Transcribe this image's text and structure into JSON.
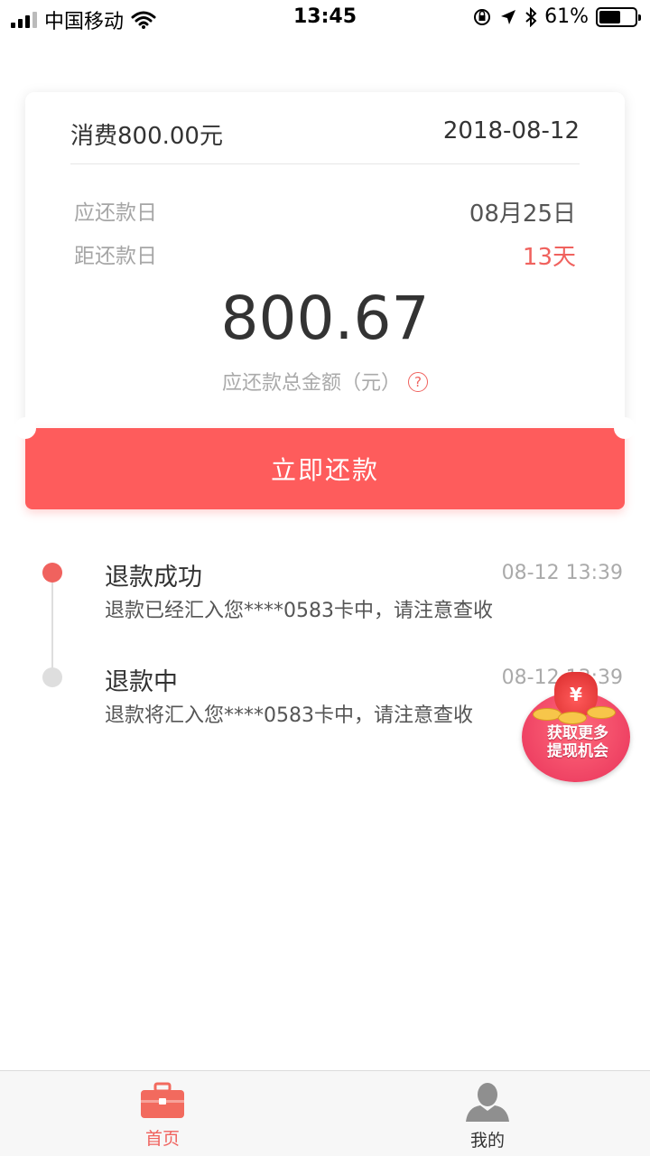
{
  "status_bar": {
    "carrier": "中国移动",
    "time": "13:45",
    "battery_percent": "61%",
    "battery_level": 0.61
  },
  "bill": {
    "title": "消费800.00元",
    "date": "2018-08-12",
    "due_label": "应还款日",
    "due_value": "08月25日",
    "remaining_label": "距还款日",
    "remaining_value": "13天",
    "amount": "800.67",
    "amount_label": "应还款总金额（元）",
    "help_icon": "question-circle-icon"
  },
  "pay_button": {
    "label": "立即还款"
  },
  "timeline": [
    {
      "title": "退款成功",
      "time": "08-12 13:39",
      "desc": "退款已经汇入您****0583卡中，请注意查收",
      "status_color": "#f0625e"
    },
    {
      "title": "退款中",
      "time": "08-12 13:39",
      "desc": "退款将汇入您****0583卡中，请注意查收",
      "status_color": "#dedede"
    }
  ],
  "promo": {
    "bag_symbol": "¥",
    "line1": "获取更多",
    "line2": "提现机会"
  },
  "tab_bar": {
    "items": [
      {
        "label": "首页",
        "icon": "briefcase-icon",
        "active": true
      },
      {
        "label": "我的",
        "icon": "user-icon",
        "active": false
      }
    ]
  },
  "colors": {
    "accent": "#fe5c5c",
    "danger_text": "#f0625e"
  }
}
